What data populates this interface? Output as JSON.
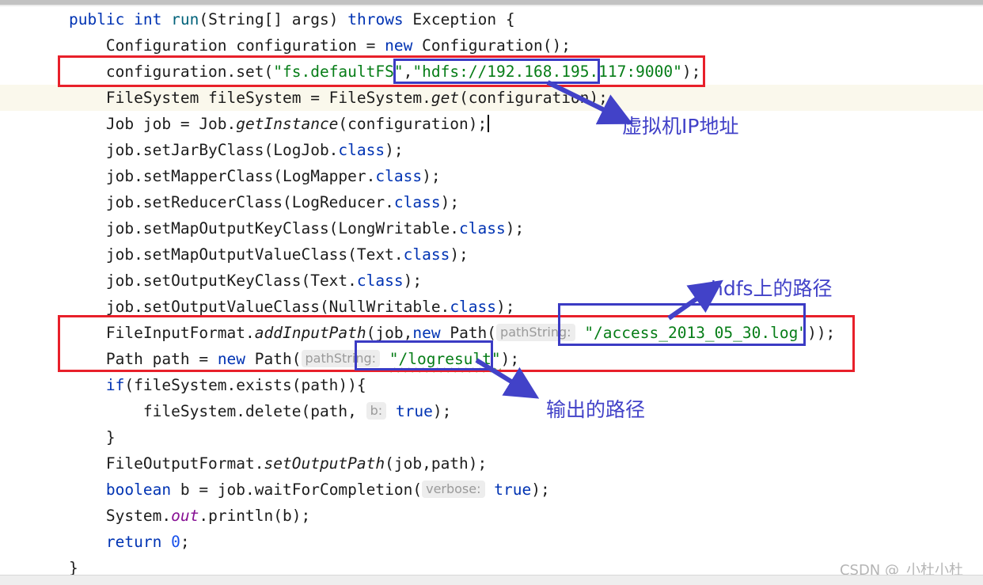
{
  "editor": {
    "font_size_px": 19.5,
    "current_line_index": 3,
    "lines": [
      {
        "id": "line-method-signature",
        "tokens": [
          {
            "t": "    ",
            "c": "pln"
          },
          {
            "t": "public",
            "c": "kw"
          },
          {
            "t": " ",
            "c": "pln"
          },
          {
            "t": "int",
            "c": "kw"
          },
          {
            "t": " ",
            "c": "pln"
          },
          {
            "t": "run",
            "c": "meth"
          },
          {
            "t": "(String[] args) ",
            "c": "pln"
          },
          {
            "t": "throws",
            "c": "kw"
          },
          {
            "t": " Exception {",
            "c": "pln"
          }
        ]
      },
      {
        "id": "line-new-configuration",
        "tokens": [
          {
            "t": "        Configuration configuration = ",
            "c": "pln"
          },
          {
            "t": "new",
            "c": "kw"
          },
          {
            "t": " Configuration();",
            "c": "pln"
          }
        ]
      },
      {
        "id": "line-configuration-set",
        "tokens": [
          {
            "t": "        configuration.set(",
            "c": "pln"
          },
          {
            "t": "\"fs.defaultFS\"",
            "c": "str"
          },
          {
            "t": ",",
            "c": "pln"
          },
          {
            "t": "\"hdfs://192.168.195.117:9000\"",
            "c": "str"
          },
          {
            "t": ");",
            "c": "pln"
          }
        ]
      },
      {
        "id": "line-filesystem-get",
        "tokens": [
          {
            "t": "        FileSystem fileSystem = FileSystem.",
            "c": "pln"
          },
          {
            "t": "get",
            "c": "ital"
          },
          {
            "t": "(configuration);",
            "c": "pln"
          }
        ]
      },
      {
        "id": "line-job-getinstance",
        "caret_at_end": true,
        "tokens": [
          {
            "t": "        Job job = Job.",
            "c": "pln"
          },
          {
            "t": "getInstance",
            "c": "ital"
          },
          {
            "t": "(configuration);",
            "c": "pln"
          }
        ]
      },
      {
        "id": "line-setjarbyclass",
        "tokens": [
          {
            "t": "        job.setJarByClass(LogJob.",
            "c": "pln"
          },
          {
            "t": "class",
            "c": "kw"
          },
          {
            "t": ");",
            "c": "pln"
          }
        ]
      },
      {
        "id": "line-setmapperclass",
        "tokens": [
          {
            "t": "        job.setMapperClass(LogMapper.",
            "c": "pln"
          },
          {
            "t": "class",
            "c": "kw"
          },
          {
            "t": ");",
            "c": "pln"
          }
        ]
      },
      {
        "id": "line-setreducerclass",
        "tokens": [
          {
            "t": "        job.setReducerClass(LogReducer.",
            "c": "pln"
          },
          {
            "t": "class",
            "c": "kw"
          },
          {
            "t": ");",
            "c": "pln"
          }
        ]
      },
      {
        "id": "line-setmapoutputkeyclass",
        "tokens": [
          {
            "t": "        job.setMapOutputKeyClass(LongWritable.",
            "c": "pln"
          },
          {
            "t": "class",
            "c": "kw"
          },
          {
            "t": ");",
            "c": "pln"
          }
        ]
      },
      {
        "id": "line-setmapoutputvalueclass",
        "tokens": [
          {
            "t": "        job.setMapOutputValueClass(Text.",
            "c": "pln"
          },
          {
            "t": "class",
            "c": "kw"
          },
          {
            "t": ");",
            "c": "pln"
          }
        ]
      },
      {
        "id": "line-setoutputkeyclass",
        "tokens": [
          {
            "t": "        job.setOutputKeyClass(Text.",
            "c": "pln"
          },
          {
            "t": "class",
            "c": "kw"
          },
          {
            "t": ");",
            "c": "pln"
          }
        ]
      },
      {
        "id": "line-setoutputvalueclass",
        "tokens": [
          {
            "t": "        job.setOutputValueClass(NullWritable.",
            "c": "pln"
          },
          {
            "t": "class",
            "c": "kw"
          },
          {
            "t": ");",
            "c": "pln"
          }
        ]
      },
      {
        "id": "line-addinputpath",
        "tokens": [
          {
            "t": "        FileInputFormat.",
            "c": "pln"
          },
          {
            "t": "addInputPath",
            "c": "ital"
          },
          {
            "t": "(job,",
            "c": "pln"
          },
          {
            "t": "new",
            "c": "kw"
          },
          {
            "t": " Path(",
            "c": "pln"
          },
          {
            "t": "pathString:",
            "c": "hint"
          },
          {
            "t": " ",
            "c": "pln"
          },
          {
            "t": "\"/access_2013_05_30.log\"",
            "c": "str"
          },
          {
            "t": "));",
            "c": "pln"
          }
        ]
      },
      {
        "id": "line-path-logresult",
        "tokens": [
          {
            "t": "        Path path = ",
            "c": "pln"
          },
          {
            "t": "new",
            "c": "kw"
          },
          {
            "t": " Path(",
            "c": "pln"
          },
          {
            "t": "pathString:",
            "c": "hint"
          },
          {
            "t": " ",
            "c": "pln"
          },
          {
            "t": "\"/logresult\"",
            "c": "str squiggle"
          },
          {
            "t": ");",
            "c": "pln"
          }
        ]
      },
      {
        "id": "line-if-exists",
        "tokens": [
          {
            "t": "        ",
            "c": "pln"
          },
          {
            "t": "if",
            "c": "kw"
          },
          {
            "t": "(fileSystem.exists(path)){",
            "c": "pln"
          }
        ]
      },
      {
        "id": "line-delete",
        "tokens": [
          {
            "t": "            fileSystem.delete(path, ",
            "c": "pln"
          },
          {
            "t": "b:",
            "c": "hint"
          },
          {
            "t": " ",
            "c": "pln"
          },
          {
            "t": "true",
            "c": "kw"
          },
          {
            "t": ");",
            "c": "pln"
          }
        ]
      },
      {
        "id": "line-close-if",
        "tokens": [
          {
            "t": "        }",
            "c": "pln"
          }
        ]
      },
      {
        "id": "line-setoutputpath",
        "tokens": [
          {
            "t": "        FileOutputFormat.",
            "c": "pln"
          },
          {
            "t": "setOutputPath",
            "c": "ital"
          },
          {
            "t": "(job,path);",
            "c": "pln"
          }
        ]
      },
      {
        "id": "line-waitforcompletion",
        "tokens": [
          {
            "t": "        ",
            "c": "pln"
          },
          {
            "t": "boolean",
            "c": "kw"
          },
          {
            "t": " b = job.waitForCompletion(",
            "c": "pln"
          },
          {
            "t": "verbose:",
            "c": "hint"
          },
          {
            "t": " ",
            "c": "pln"
          },
          {
            "t": "true",
            "c": "kw"
          },
          {
            "t": ");",
            "c": "pln"
          }
        ]
      },
      {
        "id": "line-println",
        "tokens": [
          {
            "t": "        System.",
            "c": "pln"
          },
          {
            "t": "out",
            "c": "stat"
          },
          {
            "t": ".println(b);",
            "c": "pln"
          }
        ]
      },
      {
        "id": "line-return-zero",
        "tokens": [
          {
            "t": "        ",
            "c": "pln"
          },
          {
            "t": "return",
            "c": "kw"
          },
          {
            "t": " ",
            "c": "pln"
          },
          {
            "t": "0",
            "c": "num"
          },
          {
            "t": ";",
            "c": "pln"
          }
        ]
      },
      {
        "id": "line-close-method",
        "tokens": [
          {
            "t": "    }",
            "c": "pln"
          }
        ]
      }
    ]
  },
  "annotations": {
    "vm_ip": "虚拟机IP地址",
    "hdfs_path": "hdfs上的路径",
    "output_path": "输出的路径"
  },
  "watermark": "CSDN @_小杜小杜_",
  "colors": {
    "red_box": "#e8202a",
    "blue_box": "#3b3bc4",
    "annotation_text": "#4242c8",
    "keyword": "#0033b3",
    "string": "#067d17",
    "method": "#00627a",
    "static_field": "#871094",
    "number": "#1750eb",
    "current_line_bg": "#faf8ec",
    "hint_chip_bg": "#ededed",
    "hint_chip_text": "#9a9a9a"
  }
}
